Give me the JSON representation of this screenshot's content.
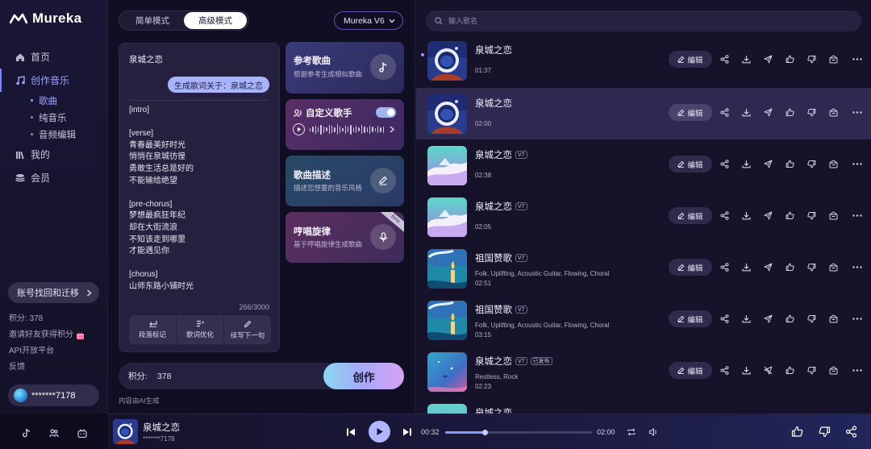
{
  "app": {
    "logo_text": "Mureka"
  },
  "sidebar": {
    "nav": [
      {
        "label": "首页",
        "icon": "home-icon"
      },
      {
        "label": "创作音乐",
        "icon": "music-note-icon",
        "active": true
      },
      {
        "label": "我的",
        "icon": "library-icon"
      },
      {
        "label": "会员",
        "icon": "coins-icon"
      }
    ],
    "sub_items": [
      {
        "label": "歌曲",
        "active": true
      },
      {
        "label": "纯音乐"
      },
      {
        "label": "音频编辑"
      }
    ],
    "recover_label": "账号找回和迁移",
    "credits_text": "积分: 378",
    "invite_text": "邀请好友获得积分",
    "api_text": "API开放平台",
    "feedback_text": "反馈",
    "user_name": "*******7178",
    "bottom_icons": [
      "tiktok-icon",
      "community-icon",
      "bilibili-icon"
    ]
  },
  "composer": {
    "mode_simple": "简单模式",
    "mode_advanced": "高级模式",
    "model": "Mureka V6",
    "lyrics_title": "泉城之恋",
    "generated_chip": "生成歌词关于：泉城之恋",
    "lyrics_body": "[intro]\n\n[verse]\n青春最美好时光\n悄悄在泉城彷徨\n勇敢生活总是好的\n不能输给绝望\n\n[pre-chorus]\n梦想最疯狂年纪\n却在大街流浪\n不知该走到哪里\n才能遇见你\n\n[chorus]\n山师东路小铺时光",
    "char_count": "266/3000",
    "tools": [
      "段落标记",
      "歌词优化",
      "续写下一句"
    ],
    "options": {
      "reference": {
        "title": "参考歌曲",
        "sub": "根据参考生成相似歌曲"
      },
      "voice": {
        "title": "自定义歌手",
        "enabled": true
      },
      "description": {
        "title": "歌曲描述",
        "sub": "描述您想要的音乐风格"
      },
      "hum": {
        "title": "哼唱旋律",
        "sub": "基于哼唱旋律生成歌曲",
        "badge": "Beta"
      }
    },
    "credits_label": "积分:",
    "credits_value": "378",
    "create_label": "创作",
    "ai_note": "内容由AI生成"
  },
  "songs": {
    "search_placeholder": "输入歌名",
    "edit_label": "编辑",
    "items": [
      {
        "title": "泉城之恋",
        "duration": "01:37",
        "badge": "",
        "tags": "",
        "cover": "astronaut"
      },
      {
        "title": "泉城之恋",
        "duration": "02:00",
        "badge": "",
        "tags": "",
        "cover": "astronaut",
        "selected": true
      },
      {
        "title": "泉城之恋",
        "duration": "02:38",
        "badge": "V7",
        "tags": "",
        "cover": "pastel"
      },
      {
        "title": "泉城之恋",
        "duration": "02:05",
        "badge": "V7",
        "tags": "",
        "cover": "pastel"
      },
      {
        "title": "祖国赞歌",
        "duration": "02:51",
        "badge": "V7",
        "tags": "Folk, Uplifting, Acoustic Guitar, Flowing, Choral",
        "cover": "candle"
      },
      {
        "title": "祖国赞歌",
        "duration": "03:15",
        "badge": "V7",
        "tags": "Folk, Uplifting, Acoustic Guitar, Flowing, Choral",
        "cover": "candle"
      },
      {
        "title": "泉城之恋",
        "duration": "02:23",
        "badge": "V7",
        "badge2": "已发布",
        "tags": "Restless, Rock",
        "cover": "ocean"
      },
      {
        "title": "泉城之恋",
        "duration": "",
        "badge": "",
        "tags": "",
        "cover": "pastel"
      }
    ]
  },
  "player": {
    "title": "泉城之恋",
    "user": "*******7178",
    "current_time": "00:32",
    "total_time": "02:00",
    "progress": 0.27
  },
  "colors": {
    "accent": "#9da4ff",
    "create_start": "#8ad8f2",
    "create_end": "#d9a2f5"
  }
}
